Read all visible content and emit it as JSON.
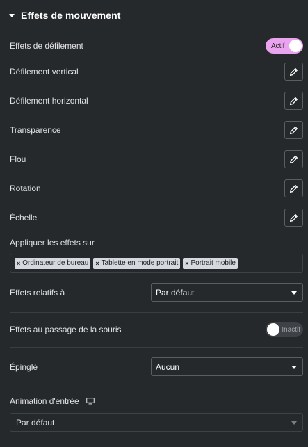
{
  "section": {
    "title": "Effets de mouvement"
  },
  "scroll_effects": {
    "label": "Effets de défilement",
    "toggle_label": "Actif",
    "enabled": true
  },
  "effects": [
    {
      "label": "Défilement vertical"
    },
    {
      "label": "Défilement horizontal"
    },
    {
      "label": "Transparence"
    },
    {
      "label": "Flou"
    },
    {
      "label": "Rotation"
    },
    {
      "label": "Échelle"
    }
  ],
  "apply_on": {
    "label": "Appliquer les effets sur",
    "tags": [
      "Ordinateur de bureau",
      "Tablette en mode portrait",
      "Portrait mobile"
    ]
  },
  "relative_to": {
    "label": "Effets relatifs à",
    "value": "Par défaut"
  },
  "mouse_effects": {
    "label": "Effets au passage de la souris",
    "toggle_label": "Inactif",
    "enabled": false
  },
  "sticky": {
    "label": "Épinglé",
    "value": "Aucun"
  },
  "entrance_animation": {
    "label": "Animation d'entrée",
    "value": "Par défaut"
  },
  "colors": {
    "accent": "#e9a3ef",
    "background": "#26292c",
    "border": "#5a5d61"
  }
}
